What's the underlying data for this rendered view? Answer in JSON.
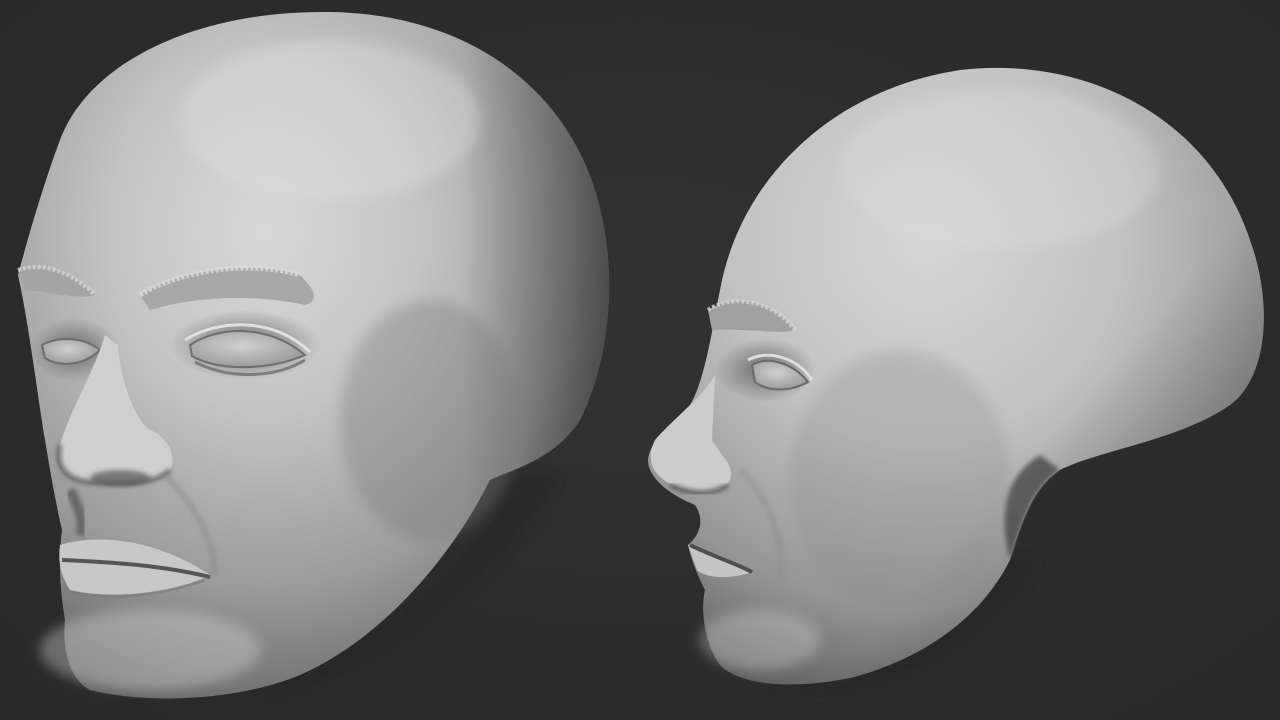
{
  "scene": {
    "background_color": "#2c2c2c",
    "material_color": "#bdbdbd",
    "views": [
      {
        "name": "three-quarter-view",
        "subject": "sculpted-head"
      },
      {
        "name": "side-profile-view",
        "subject": "sculpted-head"
      }
    ]
  }
}
